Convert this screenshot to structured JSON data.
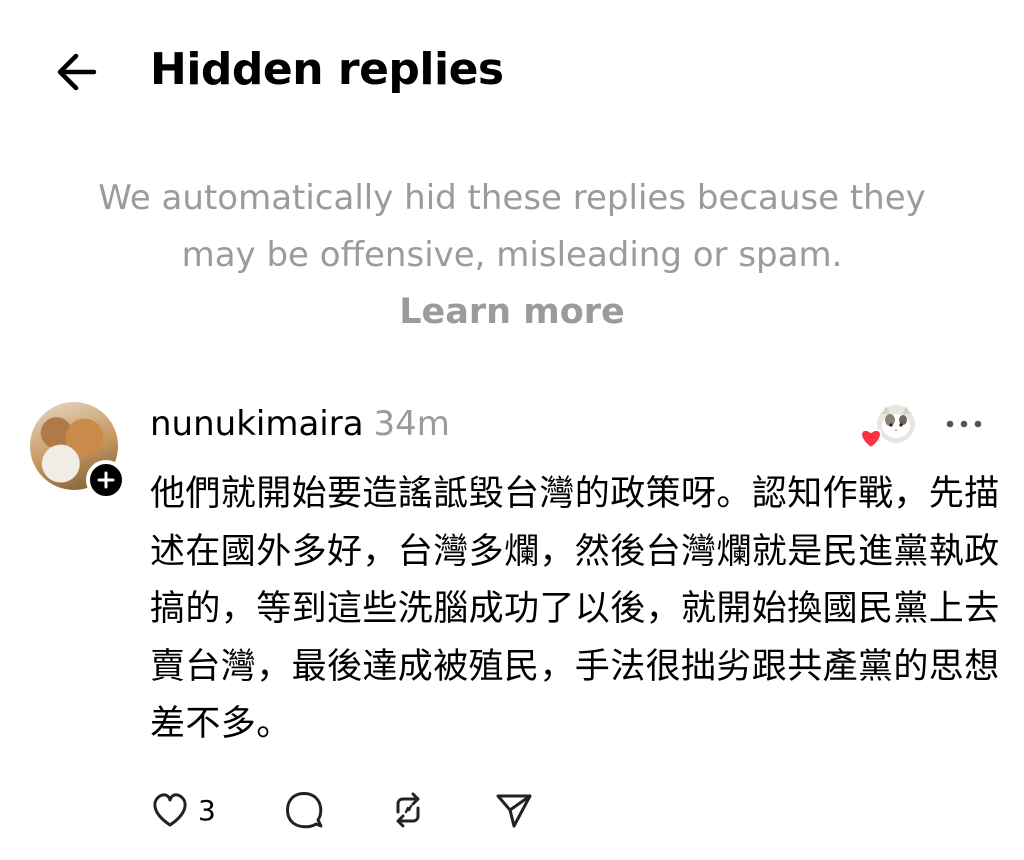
{
  "header": {
    "title": "Hidden replies",
    "back_icon": "arrow-left-icon"
  },
  "notice": {
    "text": "We automatically hid these replies because they may be offensive, misleading or spam.",
    "link": "Learn more",
    "color": "#9b9b9b"
  },
  "post": {
    "username": "nunukimaira",
    "time": "34m",
    "body": "他們就開始要造謠詆毀台灣的政策呀。認知作戰，先描述在國外多好，台灣多爛，然後台灣爛就是民進黨執政搞的，等到這些洗腦成功了以後，就開始換國民黨上去賣台灣，最後達成被殖民，手法很拙劣跟共產黨的思想差不多。",
    "actions": {
      "like_count": "3",
      "like_icon": "heart-outline-icon",
      "reply_icon": "comment-icon",
      "repost_icon": "repost-icon",
      "share_icon": "send-icon"
    },
    "liked_by_badge_color": "#ff3040"
  }
}
